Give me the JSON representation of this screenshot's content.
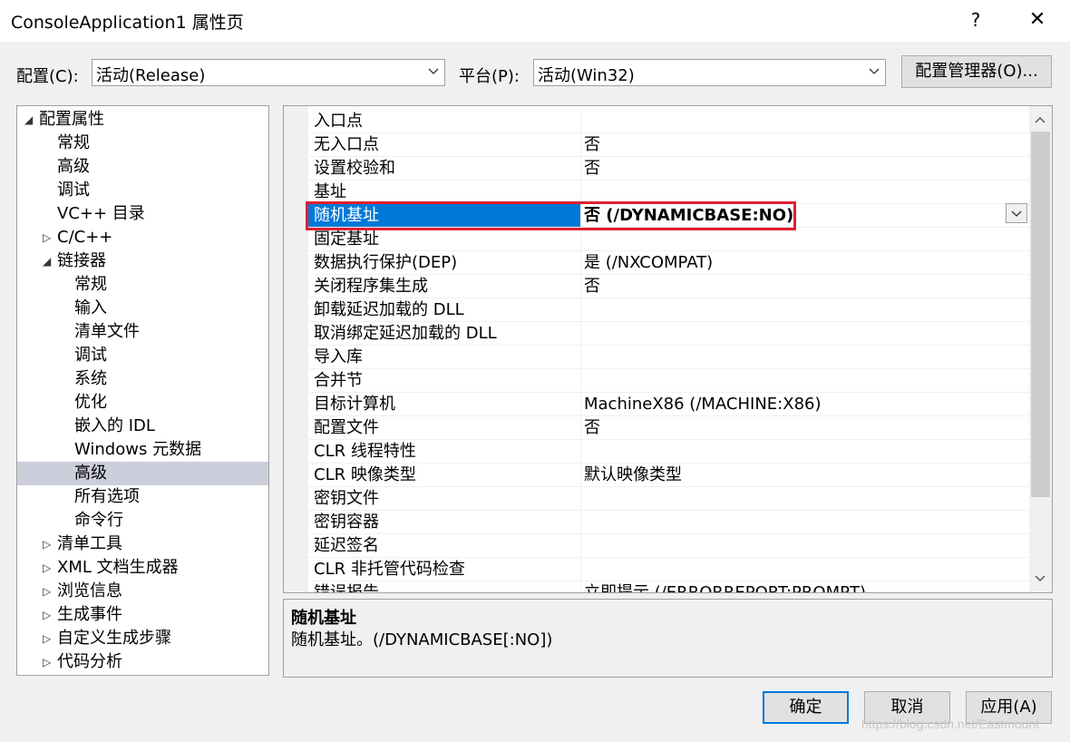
{
  "window": {
    "title": "ConsoleApplication1 属性页",
    "help": "?",
    "close": "✕"
  },
  "toolbar": {
    "config_label": "配置(C):",
    "config_value": "活动(Release)",
    "platform_label": "平台(P):",
    "platform_value": "活动(Win32)",
    "config_manager": "配置管理器(O)..."
  },
  "tree": [
    {
      "label": "配置属性",
      "level": 0,
      "expander": "expanded",
      "selected": false
    },
    {
      "label": "常规",
      "level": 1,
      "expander": "none",
      "selected": false
    },
    {
      "label": "高级",
      "level": 1,
      "expander": "none",
      "selected": false
    },
    {
      "label": "调试",
      "level": 1,
      "expander": "none",
      "selected": false
    },
    {
      "label": "VC++ 目录",
      "level": 1,
      "expander": "none",
      "selected": false
    },
    {
      "label": "C/C++",
      "level": 1,
      "expander": "collapsed",
      "selected": false
    },
    {
      "label": "链接器",
      "level": 1,
      "expander": "expanded",
      "selected": false
    },
    {
      "label": "常规",
      "level": 2,
      "expander": "none",
      "selected": false
    },
    {
      "label": "输入",
      "level": 2,
      "expander": "none",
      "selected": false
    },
    {
      "label": "清单文件",
      "level": 2,
      "expander": "none",
      "selected": false
    },
    {
      "label": "调试",
      "level": 2,
      "expander": "none",
      "selected": false
    },
    {
      "label": "系统",
      "level": 2,
      "expander": "none",
      "selected": false
    },
    {
      "label": "优化",
      "level": 2,
      "expander": "none",
      "selected": false
    },
    {
      "label": "嵌入的 IDL",
      "level": 2,
      "expander": "none",
      "selected": false
    },
    {
      "label": "Windows 元数据",
      "level": 2,
      "expander": "none",
      "selected": false
    },
    {
      "label": "高级",
      "level": 2,
      "expander": "none",
      "selected": true
    },
    {
      "label": "所有选项",
      "level": 2,
      "expander": "none",
      "selected": false
    },
    {
      "label": "命令行",
      "level": 2,
      "expander": "none",
      "selected": false
    },
    {
      "label": "清单工具",
      "level": 1,
      "expander": "collapsed",
      "selected": false
    },
    {
      "label": "XML 文档生成器",
      "level": 1,
      "expander": "collapsed",
      "selected": false
    },
    {
      "label": "浏览信息",
      "level": 1,
      "expander": "collapsed",
      "selected": false
    },
    {
      "label": "生成事件",
      "level": 1,
      "expander": "collapsed",
      "selected": false
    },
    {
      "label": "自定义生成步骤",
      "level": 1,
      "expander": "collapsed",
      "selected": false
    },
    {
      "label": "代码分析",
      "level": 1,
      "expander": "collapsed",
      "selected": false
    }
  ],
  "grid": [
    {
      "name": "入口点",
      "value": ""
    },
    {
      "name": "无入口点",
      "value": "否"
    },
    {
      "name": "设置校验和",
      "value": "否"
    },
    {
      "name": "基址",
      "value": ""
    },
    {
      "name": "随机基址",
      "value": "否 (/DYNAMICBASE:NO)",
      "selected": true
    },
    {
      "name": "固定基址",
      "value": ""
    },
    {
      "name": "数据执行保护(DEP)",
      "value": "是 (/NXCOMPAT)"
    },
    {
      "name": "关闭程序集生成",
      "value": "否"
    },
    {
      "name": "卸载延迟加载的 DLL",
      "value": ""
    },
    {
      "name": "取消绑定延迟加载的 DLL",
      "value": ""
    },
    {
      "name": "导入库",
      "value": ""
    },
    {
      "name": "合并节",
      "value": ""
    },
    {
      "name": "目标计算机",
      "value": "MachineX86 (/MACHINE:X86)"
    },
    {
      "name": "配置文件",
      "value": "否"
    },
    {
      "name": "CLR 线程特性",
      "value": ""
    },
    {
      "name": "CLR 映像类型",
      "value": "默认映像类型"
    },
    {
      "name": "密钥文件",
      "value": ""
    },
    {
      "name": "密钥容器",
      "value": ""
    },
    {
      "name": "延迟签名",
      "value": ""
    },
    {
      "name": "CLR 非托管代码检查",
      "value": ""
    },
    {
      "name": "错误报告",
      "value": "立即提示 (/ERRORREPORT:PROMPT)"
    }
  ],
  "description": {
    "title": "随机基址",
    "text": "随机基址。(/DYNAMICBASE[:NO])"
  },
  "buttons": {
    "ok": "确定",
    "cancel": "取消",
    "apply": "应用(A)"
  },
  "watermark": "https://blog.csdn.net/Eastmount",
  "colors": {
    "selection": "#0078d7",
    "tree_selection": "#cccedb",
    "highlight_box": "#e02030"
  }
}
